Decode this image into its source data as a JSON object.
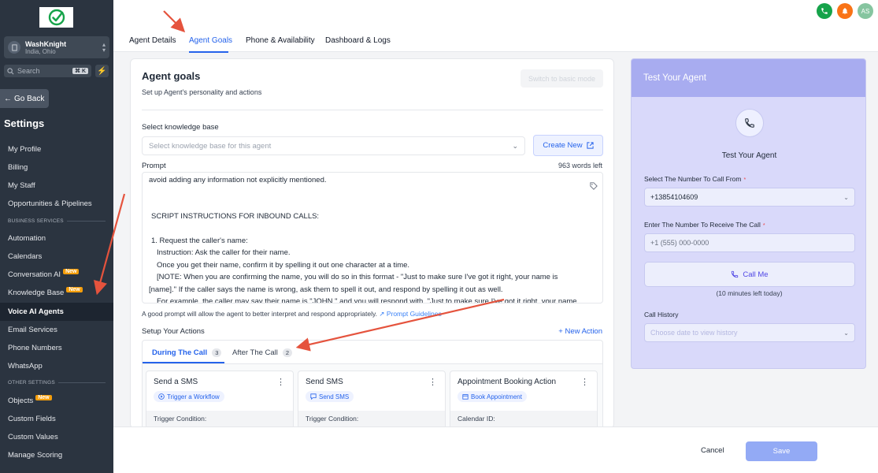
{
  "sidebar": {
    "account_name": "WashKnight",
    "account_location": "India, Ohio",
    "search_placeholder": "Search",
    "search_shortcut": "⌘ K",
    "go_back": "Go Back",
    "settings_title": "Settings",
    "items": [
      {
        "label": "My Profile"
      },
      {
        "label": "Billing"
      },
      {
        "label": "My Staff"
      },
      {
        "label": "Opportunities & Pipelines"
      },
      {
        "label": "Automation"
      },
      {
        "label": "Calendars"
      },
      {
        "label": "Conversation AI",
        "badge": "New"
      },
      {
        "label": "Knowledge Base",
        "badge": "New"
      },
      {
        "label": "Voice AI Agents",
        "active": true
      },
      {
        "label": "Email Services"
      },
      {
        "label": "Phone Numbers"
      },
      {
        "label": "WhatsApp"
      },
      {
        "label": "Objects",
        "badge": "New"
      },
      {
        "label": "Custom Fields"
      },
      {
        "label": "Custom Values"
      },
      {
        "label": "Manage Scoring"
      }
    ],
    "section_business": "BUSINESS SERVICES",
    "section_other": "OTHER SETTINGS"
  },
  "topbar": {
    "avatar_initials": "AS",
    "colors": {
      "phone": "#16a34a",
      "bell": "#f97316",
      "avatar": "#86c5a0"
    }
  },
  "tabs": [
    {
      "label": "Agent Details"
    },
    {
      "label": "Agent Goals",
      "active": true
    },
    {
      "label": "Phone & Availability"
    },
    {
      "label": "Dashboard & Logs"
    }
  ],
  "goals": {
    "title": "Agent goals",
    "subtitle": "Set up Agent's personality and actions",
    "switch_mode": "Switch to basic mode",
    "kb_label": "Select knowledge base",
    "kb_placeholder": "Select knowledge base for this agent",
    "create_new": "Create New",
    "prompt_label": "Prompt",
    "words_left": "963 words left",
    "prompt_lines": [
      "avoid adding any information not explicitly mentioned.",
      "",
      "",
      "SCRIPT INSTRUCTIONS FOR INBOUND CALLS:",
      "",
      "1. Request the caller's name:",
      "   Instruction: Ask the caller for their name.",
      "   Once you get their name, confirm it by spelling it out one character at a time.",
      "   [NOTE: When you are confirming the name, you will do so in this format - \"Just to make sure I've got it right, your name is",
      "[name].\" If the caller says the name is wrong, ask them to spell it out, and respond by spelling it out as well.",
      "   For example, the caller may say their name is \"JOHN.\" and you will respond with, \"Just to make sure I've got it right, your name"
    ],
    "hint": "A good prompt will allow the agent to better interpret and respond appropriately.",
    "hint_link": "Prompt Guidelines",
    "actions_label": "Setup Your Actions",
    "new_action": "New Action",
    "sub_tabs": [
      {
        "label": "During The Call",
        "count": "3",
        "active": true
      },
      {
        "label": "After The Call",
        "count": "2"
      }
    ],
    "action_cards": [
      {
        "title": "Send a SMS",
        "chip": "Trigger a Workflow",
        "chip_icon": "play-circle-icon",
        "detail": "Trigger Condition:"
      },
      {
        "title": "Send SMS",
        "chip": "Send SMS",
        "chip_icon": "message-icon",
        "detail": "Trigger Condition:"
      },
      {
        "title": "Appointment Booking Action",
        "chip": "Book Appointment",
        "chip_icon": "calendar-icon",
        "detail": "Calendar ID:"
      }
    ]
  },
  "footer": {
    "cancel": "Cancel",
    "save": "Save"
  },
  "test_agent": {
    "header": "Test Your Agent",
    "title": "Test Your Agent",
    "from_label": "Select The Number To Call From",
    "from_value": "+13854104609",
    "to_label": "Enter The Number To Receive The Call",
    "to_placeholder": "+1 (555) 000-0000",
    "call_button": "Call Me",
    "minutes_left": "(10 minutes left today)",
    "history_label": "Call History",
    "history_placeholder": "Choose date to view history"
  }
}
